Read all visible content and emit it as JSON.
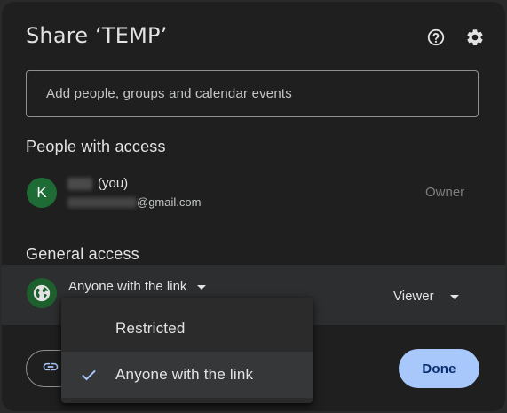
{
  "dialog": {
    "title": "Share ‘TEMP’",
    "help_icon": "help-circle-icon",
    "settings_icon": "gear-icon"
  },
  "add_input": {
    "placeholder": "Add people, groups and calendar events"
  },
  "people_section": {
    "title": "People with access",
    "people": [
      {
        "avatar_letter": "K",
        "name_suffix": "(you)",
        "email_domain": "@gmail.com",
        "role": "Owner"
      }
    ]
  },
  "general_access": {
    "title": "General access",
    "icon": "globe-icon",
    "selected": "Anyone with the link",
    "role": "Viewer"
  },
  "dropdown": {
    "options": [
      {
        "label": "Restricted",
        "checked": false
      },
      {
        "label": "Anyone with the link",
        "checked": true
      }
    ]
  },
  "footer": {
    "copy_link_icon": "link-icon",
    "done_label": "Done"
  },
  "colors": {
    "background": "#1f1f1f",
    "accent_button": "#a8c7fa",
    "accent_text": "#062e6f",
    "avatar_green": "#1e6b35",
    "check_blue": "#a8c7fa"
  }
}
